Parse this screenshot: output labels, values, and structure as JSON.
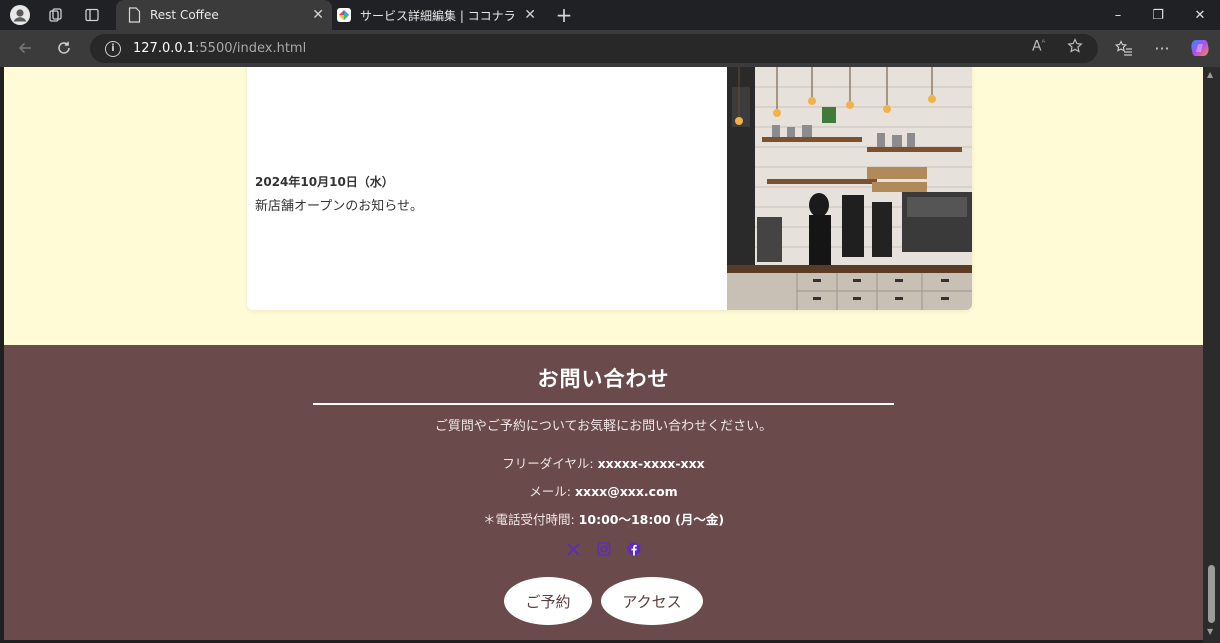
{
  "browser": {
    "tabs": [
      {
        "title": "Rest Coffee",
        "active": true,
        "favicon": "page-icon"
      },
      {
        "title": "サービス詳細編集 | ココナラ",
        "active": false,
        "favicon": "coconala-icon"
      }
    ],
    "new_tab_symbol": "+",
    "url_host": "127.0.0.1",
    "url_path": ":5500/index.html",
    "info_symbol": "i",
    "window_controls": {
      "minimize": "–",
      "restore": "❐",
      "close": "✕"
    }
  },
  "news": {
    "date": "2024年10月10日（水）",
    "body": "新店舗オープンのお知らせ。",
    "photo_alt": "cafe-interior-photo"
  },
  "contact": {
    "title": "お問い合わせ",
    "intro": "ご質問やご予約についてお気軽にお問い合わせください。",
    "free_dial_label": "フリーダイヤル:",
    "free_dial_value": "xxxxx-xxxx-xxx",
    "mail_label": "メール:",
    "mail_value": "xxxx@xxx.com",
    "hours_label": "＊電話受付時間:",
    "hours_value": "10:00〜18:00 (月〜金)",
    "social_icons": [
      "x-icon",
      "instagram-icon",
      "facebook-icon"
    ],
    "reserve_button": "ご予約",
    "access_button": "アクセス"
  },
  "colors": {
    "page_bg": "#fffbd6",
    "footer_bg": "#6a4a4a",
    "social_icon": "#5b2cc4",
    "button_text": "#5a3f3f"
  }
}
